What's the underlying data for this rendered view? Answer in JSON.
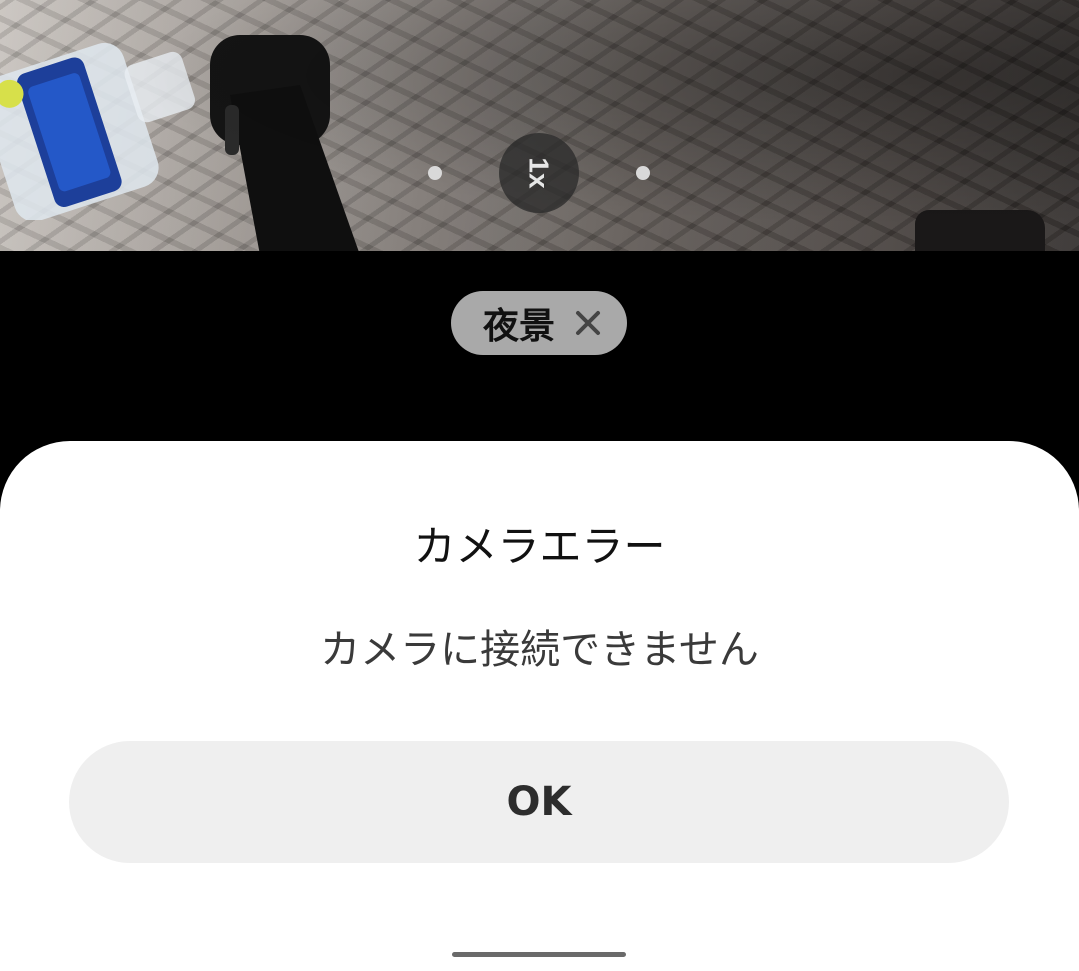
{
  "camera": {
    "zoom_label": "1x"
  },
  "scene_chip": {
    "label": "夜景",
    "close_icon": "close-icon"
  },
  "dialog": {
    "title": "カメラエラー",
    "message": "カメラに接続できません",
    "ok_label": "OK"
  },
  "colors": {
    "dialog_bg": "#ffffff",
    "button_bg": "#efefef",
    "chip_bg": "#a9a9a9"
  }
}
